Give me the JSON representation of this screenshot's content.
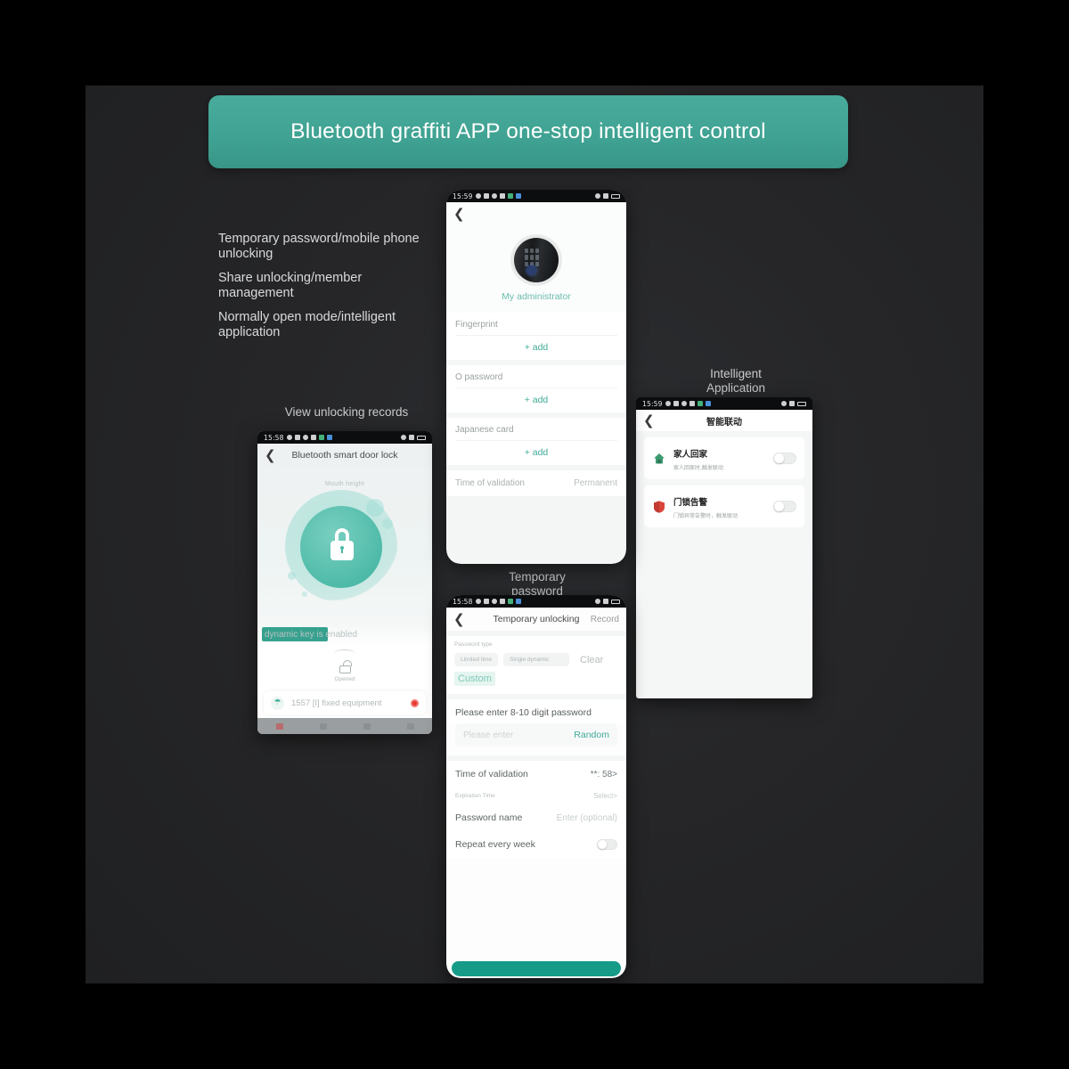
{
  "headline": "Bluetooth graffiti APP one-stop intelligent control",
  "features": [
    "Temporary password/mobile phone unlocking",
    "Share unlocking/member management",
    "Normally open mode/intelligent application"
  ],
  "captions": {
    "left": "View unlocking records",
    "right": "Intelligent Application",
    "temp": "Temporary password"
  },
  "colors": {
    "accent": "#3faa97",
    "headline_bg": "#41a292",
    "panel_bg": "#262628",
    "alert_red": "#e8352c"
  },
  "phone_left": {
    "status_time": "15:58",
    "nav_title": "Bluetooth smart door lock",
    "back_icon": "chevron-left-icon",
    "hero_label": "Mouth height",
    "lock_icon": "padlock-icon",
    "dynamic_text": "dynamic key is enabled",
    "opened_icon": "unlocked-padlock-icon",
    "opened_label": "Opened",
    "alert_icon": "bell-icon",
    "alert_text": "1557 [I] fixed equipment"
  },
  "phone_center": {
    "status_time": "15:59",
    "back_icon": "chevron-left-icon",
    "avatar_name": "avatar",
    "admin_name": "My administrator",
    "sections": [
      {
        "label": "Fingerprint",
        "action": "+ add"
      },
      {
        "label": "O password",
        "action": "+ add"
      },
      {
        "label": "Japanese card",
        "action": "+ add"
      }
    ],
    "validation_label": "Time of validation",
    "validation_value": "Permanent"
  },
  "phone_temp": {
    "status_time": "15:58",
    "back_icon": "chevron-left-icon",
    "nav_title": "Temporary unlocking",
    "nav_right": "Record",
    "password_type_label": "Password type",
    "chips": [
      "Limited time",
      "Single dynamic",
      ""
    ],
    "clear_label": "Clear",
    "custom_label": "Custom",
    "field_title": "Please enter 8-10 digit password",
    "field_placeholder": "Please enter",
    "random_label": "Random",
    "rows": [
      {
        "label": "Time of validation",
        "value": "**: 58>"
      },
      {
        "label": "Expiration Time",
        "value": "Select>"
      },
      {
        "label": "Password name",
        "value": "Enter (optional)"
      }
    ],
    "repeat_label": "Repeat every week",
    "repeat_toggle": "off"
  },
  "phone_right": {
    "status_time": "15:59",
    "back_icon": "chevron-left-icon",
    "nav_title": "智能联动",
    "items": [
      {
        "icon": "home-icon",
        "title": "家人回家",
        "sub": "家人回家时,触发联动",
        "toggle": "off"
      },
      {
        "icon": "shield-icon",
        "title": "门锁告警",
        "sub": "门锁异常告警时，触发联动",
        "toggle": "off"
      }
    ]
  }
}
